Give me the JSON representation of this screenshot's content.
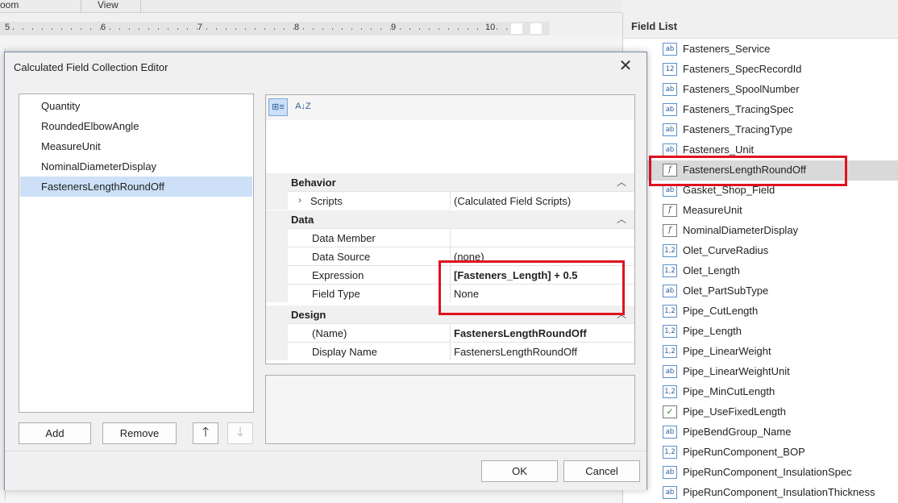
{
  "menu": {
    "items": [
      "oom",
      "View"
    ]
  },
  "ruler": {
    "numbers": [
      "5",
      "6",
      "7",
      "8",
      "9",
      "10"
    ]
  },
  "field_list": {
    "title": "Field List",
    "items": [
      {
        "type": "ab",
        "label": "Fasteners_Service"
      },
      {
        "type": "12",
        "label": "Fasteners_SpecRecordId"
      },
      {
        "type": "ab",
        "label": "Fasteners_SpoolNumber"
      },
      {
        "type": "ab",
        "label": "Fasteners_TracingSpec"
      },
      {
        "type": "ab",
        "label": "Fasteners_TracingType"
      },
      {
        "type": "ab",
        "label": "Fasteners_Unit"
      },
      {
        "type": "f",
        "label": "FastenersLengthRoundOff",
        "selected": true
      },
      {
        "type": "ab",
        "label": "Gasket_Shop_Field"
      },
      {
        "type": "f",
        "label": "MeasureUnit"
      },
      {
        "type": "f",
        "label": "NominalDiameterDisplay"
      },
      {
        "type": "1,2",
        "label": "Olet_CurveRadius"
      },
      {
        "type": "1,2",
        "label": "Olet_Length"
      },
      {
        "type": "ab",
        "label": "Olet_PartSubType"
      },
      {
        "type": "1,2",
        "label": "Pipe_CutLength"
      },
      {
        "type": "1,2",
        "label": "Pipe_Length"
      },
      {
        "type": "1,2",
        "label": "Pipe_LinearWeight"
      },
      {
        "type": "ab",
        "label": "Pipe_LinearWeightUnit"
      },
      {
        "type": "1,2",
        "label": "Pipe_MinCutLength"
      },
      {
        "type": "check",
        "label": "Pipe_UseFixedLength"
      },
      {
        "type": "ab",
        "label": "PipeBendGroup_Name"
      },
      {
        "type": "1,2",
        "label": "PipeRunComponent_BOP"
      },
      {
        "type": "ab",
        "label": "PipeRunComponent_InsulationSpec"
      },
      {
        "type": "ab",
        "label": "PipeRunComponent_InsulationThickness"
      }
    ]
  },
  "dialog": {
    "title": "Calculated Field Collection Editor",
    "close_glyph": "✕",
    "collection": [
      {
        "label": "Quantity"
      },
      {
        "label": "RoundedElbowAngle"
      },
      {
        "label": "MeasureUnit"
      },
      {
        "label": "NominalDiameterDisplay"
      },
      {
        "label": "FastenersLengthRoundOff",
        "selected": true
      }
    ],
    "buttons": {
      "add": "Add",
      "remove": "Remove",
      "move_up": "🡑",
      "move_down": "🡓",
      "ok": "OK",
      "cancel": "Cancel"
    },
    "property_grid": {
      "toolbar": {
        "categorized_icon": "⊞≡",
        "alphabetical_icon": "A↓Z"
      },
      "categories": [
        {
          "name": "Behavior",
          "rows": [
            {
              "key": "Scripts",
              "value": "(Calculated Field Scripts)",
              "expandable": true
            }
          ]
        },
        {
          "name": "Data",
          "rows": [
            {
              "key": "Data Member",
              "value": ""
            },
            {
              "key": "Data Source",
              "value": "(none)"
            },
            {
              "key": "Expression",
              "value": "[Fasteners_Length] + 0.5",
              "bold": true
            },
            {
              "key": "Field Type",
              "value": "None"
            }
          ]
        },
        {
          "name": "Design",
          "rows": [
            {
              "key": "(Name)",
              "value": "FastenersLengthRoundOff",
              "bold": true
            },
            {
              "key": "Display Name",
              "value": "FastenersLengthRoundOff"
            }
          ]
        }
      ]
    }
  },
  "colors": {
    "highlight": "#e0121f",
    "selection": "#cde0f7"
  }
}
